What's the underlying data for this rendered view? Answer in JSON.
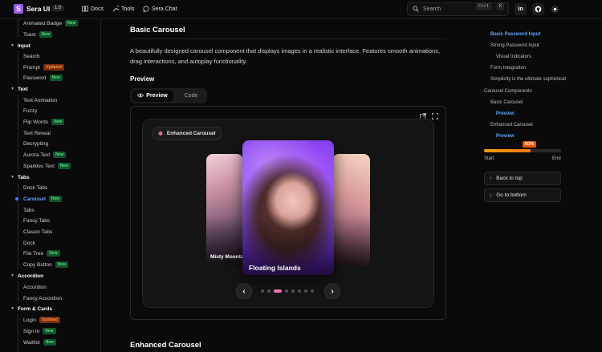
{
  "header": {
    "logo_letter": "S",
    "brand": "Sera UI",
    "version": "1.0",
    "nav": [
      {
        "label": "Docs",
        "icon": "book-icon"
      },
      {
        "label": "Tools",
        "icon": "wrench-icon"
      },
      {
        "label": "Sera Chat",
        "icon": "chat-icon"
      }
    ],
    "search_placeholder": "Search",
    "shortcut_ctrl": "Ctrl",
    "shortcut_key": "K",
    "actions": [
      "linkedin-icon",
      "github-icon",
      "theme-toggle-icon"
    ]
  },
  "sidebar": {
    "top_items": [
      {
        "label": "Animated Badge",
        "badge": "New"
      },
      {
        "label": "Toast",
        "badge": "New"
      }
    ],
    "input": {
      "title": "Input",
      "items": [
        {
          "label": "Search",
          "badge": ""
        },
        {
          "label": "Prompt",
          "badge": "Updated"
        },
        {
          "label": "Password",
          "badge": "New"
        }
      ]
    },
    "text": {
      "title": "Text",
      "items": [
        {
          "label": "Text Animation",
          "badge": ""
        },
        {
          "label": "Fuzzy",
          "badge": ""
        },
        {
          "label": "Flip Words",
          "badge": "New"
        },
        {
          "label": "Text Reveal",
          "badge": ""
        },
        {
          "label": "Decrypting",
          "badge": ""
        },
        {
          "label": "Aurora Text",
          "badge": "New"
        },
        {
          "label": "Sparkles Text",
          "badge": "New"
        }
      ]
    },
    "tabs": {
      "title": "Tabs",
      "items": [
        {
          "label": "Dock Tabs",
          "badge": ""
        },
        {
          "label": "Carousel",
          "badge": "New",
          "active": true
        },
        {
          "label": "Tabs",
          "badge": ""
        },
        {
          "label": "Fancy Tabs",
          "badge": ""
        },
        {
          "label": "Classic Tabs",
          "badge": ""
        },
        {
          "label": "Dock",
          "badge": ""
        },
        {
          "label": "File Tree",
          "badge": "New"
        },
        {
          "label": "Copy Button",
          "badge": "New"
        }
      ]
    },
    "accordion": {
      "title": "Accordion",
      "items": [
        {
          "label": "Accordion",
          "badge": ""
        },
        {
          "label": "Fancy Accordion",
          "badge": ""
        }
      ]
    },
    "forms": {
      "title": "Form & Cards",
      "items": [
        {
          "label": "Login",
          "badge": "Updated"
        },
        {
          "label": "Sign In",
          "badge": "New"
        },
        {
          "label": "Waitlist",
          "badge": "New"
        }
      ]
    }
  },
  "main": {
    "heading": "Basic Carousel",
    "description": "A beautifully designed carousel component that displays images in a realistic interface. Features smooth animations, drag interactions, and autoplay functionality.",
    "preview_heading": "Preview",
    "tab_preview": "Preview",
    "tab_code": "Code",
    "demo_pill": "Enhanced Carousel",
    "main_caption": "Floating Islands",
    "left_caption": "Misty Mountains",
    "dot_count": 8,
    "active_dot": 2,
    "next_heading": "Enhanced Carousel"
  },
  "toc": {
    "items": [
      {
        "label": "Basic Password Input",
        "level": 1,
        "highlight": true
      },
      {
        "label": "Strong Password Input",
        "level": 1,
        "highlight": false
      },
      {
        "label": "Visual Indicators",
        "level": 2,
        "highlight": false
      },
      {
        "label": "Form Integration",
        "level": 1,
        "highlight": false
      },
      {
        "label": "Simplicity is the ultimate sophisticat",
        "level": 1,
        "highlight": false
      },
      {
        "label": "Carousel Components",
        "level": 0,
        "highlight": false
      },
      {
        "label": "Basic Carousel",
        "level": 1,
        "highlight": false
      },
      {
        "label": "Preview",
        "level": 2,
        "highlight": true
      },
      {
        "label": "Enhanced Carousel",
        "level": 1,
        "highlight": false
      },
      {
        "label": "Preview",
        "level": 2,
        "highlight": true
      }
    ],
    "progress_label": "60%",
    "progress_value": 0.6,
    "start_label": "Start",
    "end_label": "End",
    "back_to_top": "Back to top",
    "go_to_bottom": "Go to bottom"
  }
}
